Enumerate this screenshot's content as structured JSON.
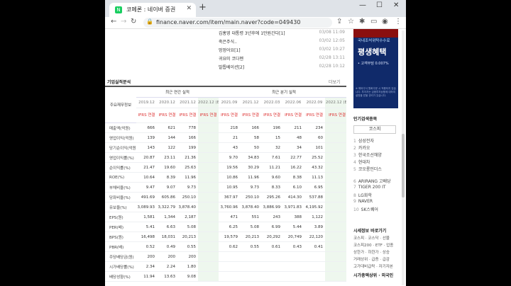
{
  "browser": {
    "tab_title": "코메론 : 네이버 증권",
    "favicon": "N",
    "new_tab_label": "+",
    "url": "finance.naver.com/item/main.naver?code=049430",
    "win_min": "—",
    "win_max": "☐",
    "win_close": "✕"
  },
  "news": [
    {
      "title": "김홍영 대통령 3년후에 1만원간다[1]",
      "date": "03/08 11:09"
    },
    {
      "title": "죽은주식..",
      "date": "03/02 12:05"
    },
    {
      "title": "멍멍어요[1]",
      "date": "03/02 10:27"
    },
    {
      "title": "귀요미 코다멘",
      "date": "02/28 13:11"
    },
    {
      "title": "발톱베이션[2]",
      "date": "02/28 10:12"
    }
  ],
  "section": {
    "title": "기업실적분석",
    "more": "더보기"
  },
  "table": {
    "row_header": "주요재무정보",
    "annual_label": "최근 연간 실적",
    "quarter_label": "최근 분기 실적",
    "annual_cols": [
      "2019.12",
      "2020.12",
      "2021.12",
      "2022.12 (E)"
    ],
    "quarter_cols": [
      "2021.09",
      "2021.12",
      "2022.03",
      "2022.06",
      "2022.09",
      "2022.12 (E)"
    ],
    "ifrs_label": "IFRS 연결",
    "rows": [
      {
        "label": "매출액(억원)",
        "values": [
          "666",
          "621",
          "778",
          "",
          "218",
          "166",
          "196",
          "211",
          "234",
          ""
        ]
      },
      {
        "label": "영업이익(억원)",
        "values": [
          "139",
          "144",
          "166",
          "",
          "21",
          "58",
          "15",
          "48",
          "60",
          ""
        ]
      },
      {
        "label": "당기순이익(억원)",
        "values": [
          "143",
          "122",
          "199",
          "",
          "43",
          "50",
          "32",
          "34",
          "101",
          ""
        ]
      },
      {
        "label": "영업이익률(%)",
        "values": [
          "20.87",
          "23.11",
          "21.36",
          "",
          "9.70",
          "34.83",
          "7.61",
          "22.77",
          "25.52",
          ""
        ]
      },
      {
        "label": "순이익률(%)",
        "values": [
          "21.47",
          "19.60",
          "25.63",
          "",
          "19.56",
          "30.29",
          "11.21",
          "16.22",
          "43.32",
          ""
        ]
      },
      {
        "label": "ROE(%)",
        "values": [
          "10.64",
          "8.39",
          "11.96",
          "",
          "10.86",
          "11.96",
          "9.60",
          "8.38",
          "11.13",
          ""
        ]
      },
      {
        "label": "부채비율(%)",
        "values": [
          "9.47",
          "9.07",
          "9.73",
          "",
          "10.95",
          "9.73",
          "8.33",
          "6.10",
          "6.95",
          ""
        ]
      },
      {
        "label": "당좌비율(%)",
        "values": [
          "491.69",
          "605.86",
          "250.10",
          "",
          "367.97",
          "250.10",
          "295.26",
          "414.30",
          "537.88",
          ""
        ]
      },
      {
        "label": "유보율(%)",
        "values": [
          "3,089.93",
          "3,322.79",
          "3,878.40",
          "",
          "3,760.96",
          "3,878.40",
          "3,886.99",
          "3,971.83",
          "4,195.92",
          ""
        ]
      },
      {
        "label": "EPS(원)",
        "values": [
          "1,581",
          "1,344",
          "2,187",
          "",
          "471",
          "551",
          "243",
          "388",
          "1,122",
          ""
        ]
      },
      {
        "label": "PER(배)",
        "values": [
          "5.41",
          "6.63",
          "5.08",
          "",
          "6.25",
          "5.08",
          "6.99",
          "5.44",
          "3.89",
          ""
        ]
      },
      {
        "label": "BPS(원)",
        "values": [
          "16,498",
          "18,031",
          "20,213",
          "",
          "19,579",
          "20,213",
          "20,292",
          "20,749",
          "22,120",
          ""
        ]
      },
      {
        "label": "PBR(배)",
        "values": [
          "0.52",
          "0.49",
          "0.55",
          "",
          "0.62",
          "0.55",
          "0.61",
          "0.43",
          "0.41",
          ""
        ]
      },
      {
        "label": "주당배당금(원)",
        "values": [
          "200",
          "200",
          "200",
          "",
          "",
          "",
          "",
          "",
          "",
          ""
        ]
      },
      {
        "label": "시가배당률(%)",
        "values": [
          "2.34",
          "2.24",
          "1.80",
          "",
          "",
          "",
          "",
          "",
          "",
          ""
        ]
      },
      {
        "label": "배당성향(%)",
        "values": [
          "11.94",
          "13.63",
          "9.08",
          "",
          "",
          "",
          "",
          "",
          "",
          ""
        ]
      }
    ]
  },
  "right": {
    "ad_line1": "국내조석위탁수수료",
    "ad_line2": "평생혜택",
    "ad_line3": "• 고객부담 0.007%",
    "ad_note": "※ 해외주식 원화주문 시 적용되지 않습니다. 투자자는 금융투자상품에 대하여 설명을 받을 권리가 있습니다.",
    "popular_title": "인기검색종목",
    "popular_tab": "코스피",
    "popular": [
      "삼성전자",
      "카카오",
      "한국조선해양",
      "현대차",
      "코오롱인더스",
      "ARIRANG 고배당",
      "TIGER 200 IT",
      "LG화학",
      "NAVER",
      "SK스퀘어"
    ],
    "market_title": "시세정보 바로가기",
    "market_links": "코스피 · 코스닥 · 선물",
    "market_links2": "코스피200 · ETF · 업종",
    "market_links3": "상한가 · 하한가 · 상승",
    "market_links4": "거래상위 · 급증 · 급감",
    "market_links5": "고가대비급락 · 자기자본",
    "market_title2": "시가총액상위 · 외국인"
  }
}
